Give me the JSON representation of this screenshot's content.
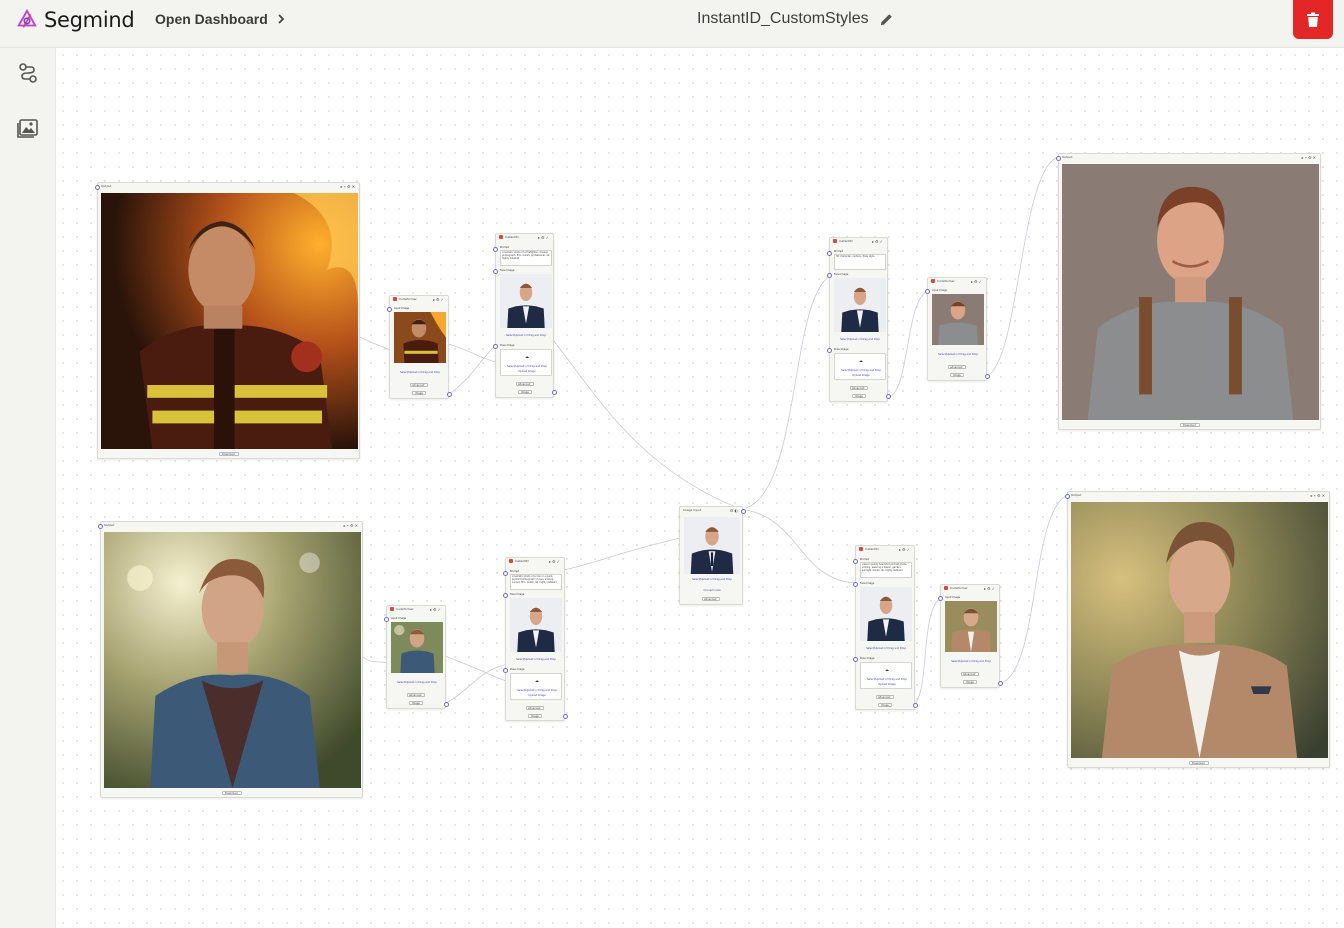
{
  "app": {
    "brand": "Segmind"
  },
  "header": {
    "open_dashboard": "Open Dashboard",
    "workflow_title": "InstantID_CustomStyles"
  },
  "sidebar": {
    "items": [
      {
        "icon": "workflow-icon"
      },
      {
        "icon": "gallery-icon"
      }
    ]
  },
  "colors": {
    "accent": "#e32727",
    "brand": "#c23fd1",
    "handle": "#6b6bd6",
    "edge": "#c9c9d6"
  },
  "canvas": {
    "nodes": {
      "out_fire": {
        "title": "Output",
        "footer": "Download"
      },
      "out_park": {
        "title": "Output",
        "footer": "Download"
      },
      "out_casual": {
        "title": "Output",
        "footer": "Download"
      },
      "out_suit": {
        "title": "Output",
        "footer": "Download"
      },
      "upscale_1": {
        "title": "Codeformer",
        "input_label": "Input Image",
        "hint": "Select/Upload or Drag and Drop",
        "b1": "Advanced",
        "b2": "Image"
      },
      "upscale_2": {
        "title": "Codeformer",
        "input_label": "Input Image",
        "hint": "Select/Upload or Drag and Drop",
        "b1": "Advanced",
        "b2": "Image"
      },
      "upscale_3": {
        "title": "Codeformer",
        "input_label": "Input Image",
        "hint": "Select/Upload or Drag and Drop",
        "b1": "Advanced",
        "b2": "Image"
      },
      "upscale_4": {
        "title": "Codeformer",
        "input_label": "Input Image",
        "hint": "Select/Upload or Drag and Drop",
        "b1": "Advanced",
        "b2": "Image"
      },
      "instantid_1": {
        "title": "InstantID",
        "prompt_label": "Prompt",
        "prompt_text": "cinematic photo of a firefighter, closeup photograph, film, bokeh, professional, 4k, highly detailed",
        "face_label": "Face Image",
        "pose_label": "Pose Image",
        "hint": "Select/Upload or Drag and Drop",
        "upload": "Upload Image",
        "b1": "Advanced",
        "b2": "Image"
      },
      "instantid_2": {
        "title": "InstantID",
        "prompt_label": "Prompt",
        "prompt_text": "3D character, cartoon, Pixar style",
        "face_label": "Face Image",
        "pose_label": "Pose Image",
        "hint": "Select/Upload or Drag and Drop",
        "upload": "Upload Image",
        "b1": "Advanced",
        "b2": "Image"
      },
      "instantid_3": {
        "title": "InstantID",
        "prompt_label": "Prompt",
        "prompt_text": "cinematic photo of a man in a park, portrait photograph of man, smiling, sunset, film, bokeh, 4k, highly detailed",
        "face_label": "Face Image",
        "pose_label": "Pose Image",
        "hint": "Select/Upload or Drag and Drop",
        "upload": "Upload Image",
        "b1": "Advanced",
        "b2": "Image"
      },
      "instantid_4": {
        "title": "InstantID",
        "prompt_label": "Prompt",
        "prompt_text": "classic quality headshot portrait photo, smiling, wearing a blazer, garden, sunlight, bokeh, 4k, highly detailed",
        "face_label": "Face Image",
        "pose_label": "Pose Image",
        "hint": "Select/Upload or Drag and Drop",
        "upload": "Upload Image",
        "b1": "Advanced",
        "b2": "Image"
      },
      "image_input": {
        "title": "Image Input",
        "hint": "Select/Upload or Drag and Drop",
        "link": "Connect node",
        "b1": "Advanced"
      }
    }
  }
}
